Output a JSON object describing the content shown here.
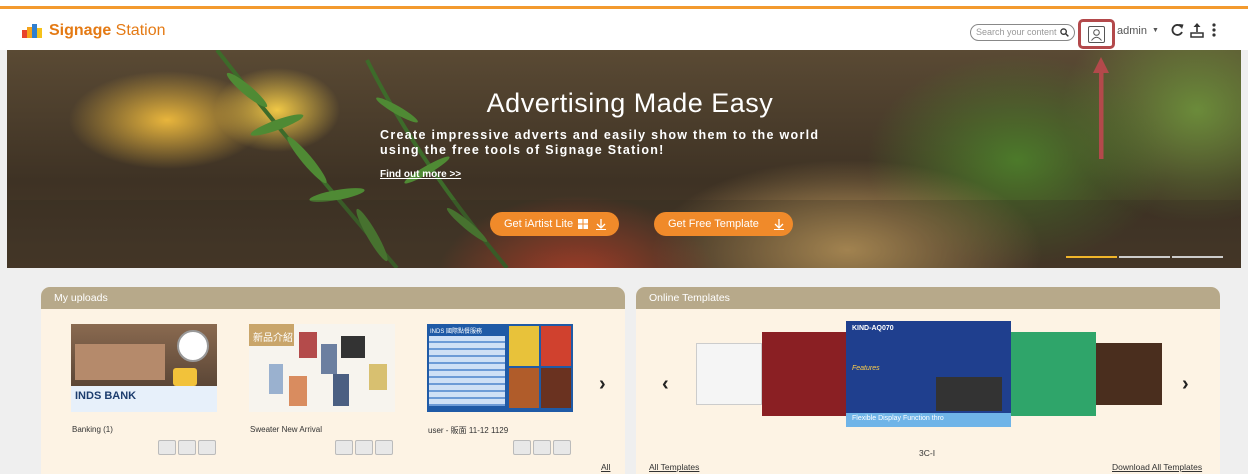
{
  "app": {
    "logo_bold": "Signage",
    "logo_rest": " Station",
    "brand_color": "#e47a14",
    "accent_bar_color": "#f39a2e"
  },
  "header": {
    "search_placeholder": "Search your content",
    "user": "admin",
    "icons": [
      "search-icon",
      "user-icon",
      "refresh-icon",
      "upload-icon",
      "more-icon"
    ]
  },
  "hero": {
    "title": "Advertising Made Easy",
    "subtitle_line1": "Create impressive adverts and easily show them to the world",
    "subtitle_line2": "using the free tools of Signage Station!",
    "link": "Find out more >>",
    "button1": "Get iArtist Lite",
    "button2": "Get Free Template",
    "slide_count": 3,
    "active_slide": 1
  },
  "uploads": {
    "title": "My uploads",
    "items": [
      {
        "label": "Banking (1)",
        "thumb_text": "INDS BANK"
      },
      {
        "label": "Sweater New Arrival",
        "thumb_text": "新品介紹"
      },
      {
        "label": "user - 販面 11-12 1129",
        "thumb_text": "INDS 國際點餐服務"
      }
    ],
    "footer_link": "All"
  },
  "templates": {
    "title": "Online Templates",
    "featured_caption": "3C-I",
    "featured_title": "KIND-AQ070",
    "featured_heading": "Features",
    "featured_footer": "Flexible Display Function thro",
    "footer_left": "All Templates",
    "footer_right": "Download All Templates"
  }
}
